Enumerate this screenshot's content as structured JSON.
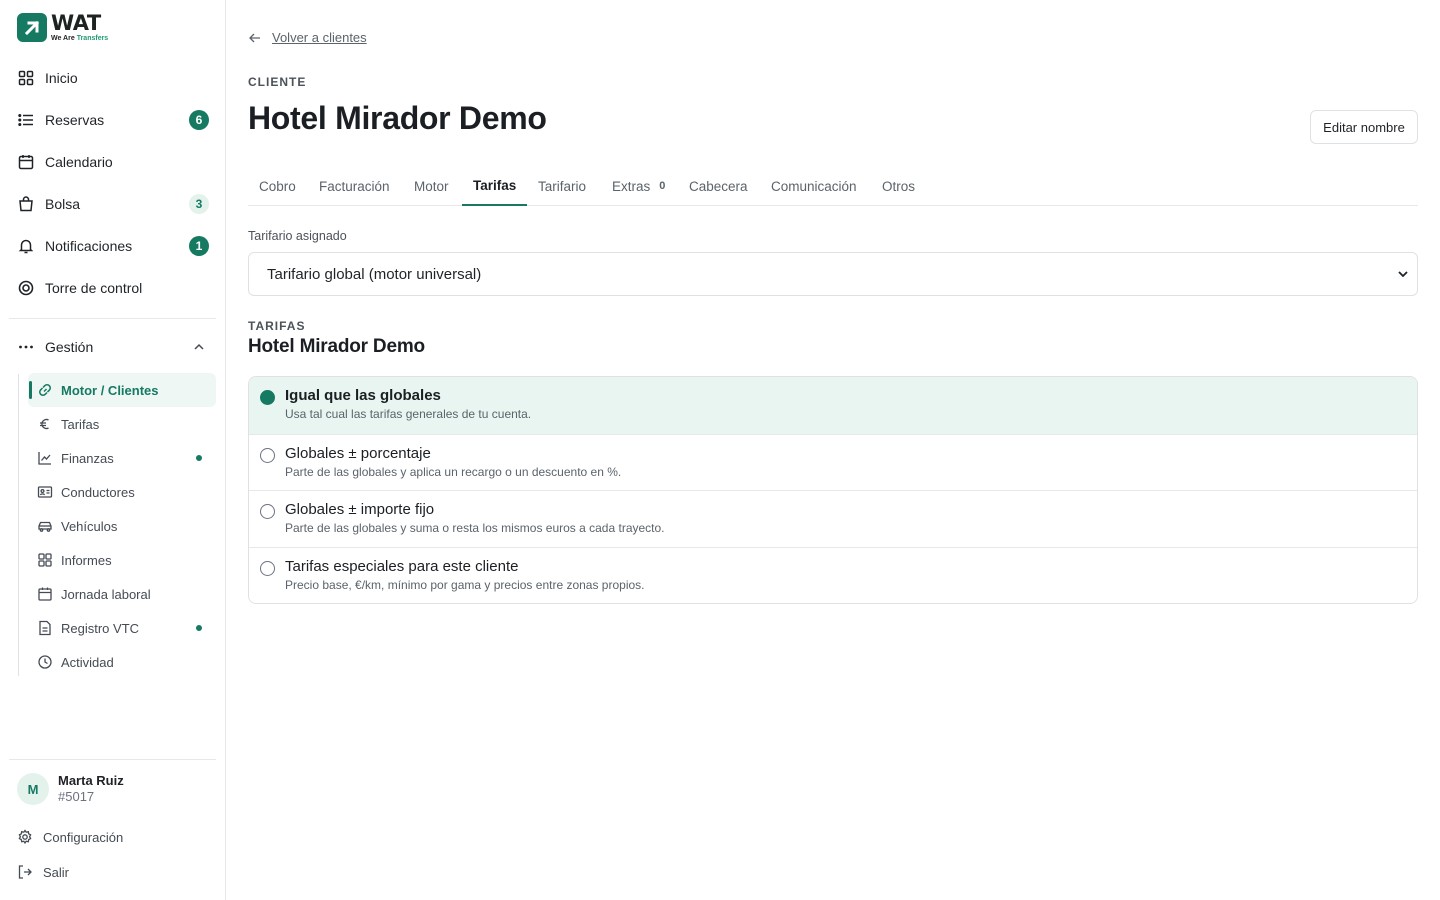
{
  "brand": {
    "word": "WAT",
    "tag_prefix": "We Are ",
    "tag_green": "Transfers",
    "accent": "#167a63"
  },
  "sidebar": {
    "nav": [
      {
        "label": "Inicio",
        "icon": "grid-icon"
      },
      {
        "label": "Reservas",
        "icon": "list-icon",
        "badge": "6"
      },
      {
        "label": "Calendario",
        "icon": "calendar-icon"
      },
      {
        "label": "Bolsa",
        "icon": "bag-icon",
        "badge": "3"
      },
      {
        "label": "Notificaciones",
        "icon": "bell-icon",
        "badge": "1"
      },
      {
        "label": "Torre de control",
        "icon": "target-icon"
      }
    ],
    "section": {
      "label": "Gestión",
      "icon": "more-icon"
    },
    "sub": [
      {
        "label": "Motor / Clientes",
        "icon": "link-icon"
      },
      {
        "label": "Tarifas",
        "icon": "euro-icon"
      },
      {
        "label": "Finanzas",
        "icon": "chart-icon"
      },
      {
        "label": "Conductores",
        "icon": "id-card-icon"
      },
      {
        "label": "Vehículos",
        "icon": "car-icon"
      },
      {
        "label": "Informes",
        "icon": "grid-icon"
      },
      {
        "label": "Jornada laboral",
        "icon": "calendar-icon"
      },
      {
        "label": "Registro VTC",
        "icon": "document-icon"
      },
      {
        "label": "Actividad",
        "icon": "clock-icon"
      }
    ],
    "user": {
      "initial": "M",
      "name": "Marta Ruiz",
      "id": "#5017"
    },
    "footer": [
      {
        "label": "Configuración",
        "icon": "gear-icon"
      },
      {
        "label": "Salir",
        "icon": "logout-icon"
      }
    ]
  },
  "main": {
    "back_label": "Volver a clientes",
    "eyebrow": "CLIENTE",
    "title": "Hotel Mirador Demo",
    "edit_label": "Editar nombre",
    "tabs": [
      {
        "label": "Cobro"
      },
      {
        "label": "Facturación"
      },
      {
        "label": "Motor"
      },
      {
        "label": "Tarifas"
      },
      {
        "label": "Tarifario"
      },
      {
        "label": "Extras",
        "count": "0"
      },
      {
        "label": "Cabecera"
      },
      {
        "label": "Comunicación"
      },
      {
        "label": "Otros"
      }
    ],
    "active_tab": "Tarifas",
    "field_label": "Tarifario asignado",
    "select_value": "Tarifario global (motor universal)",
    "section_eyebrow": "TARIFAS",
    "section_title": "Hotel Mirador Demo",
    "options": [
      {
        "title": "Igual que las globales",
        "desc": "Usa tal cual las tarifas generales de tu cuenta.",
        "selected": true
      },
      {
        "title": "Globales ± porcentaje",
        "desc": "Parte de las globales y aplica un recargo o un descuento en %.",
        "selected": false
      },
      {
        "title": "Globales ± importe fijo",
        "desc": "Parte de las globales y suma o resta los mismos euros a cada trayecto.",
        "selected": false
      },
      {
        "title": "Tarifas especiales para este cliente",
        "desc": "Precio base, €/km, mínimo por gama y precios entre zonas propios.",
        "selected": false
      }
    ]
  }
}
